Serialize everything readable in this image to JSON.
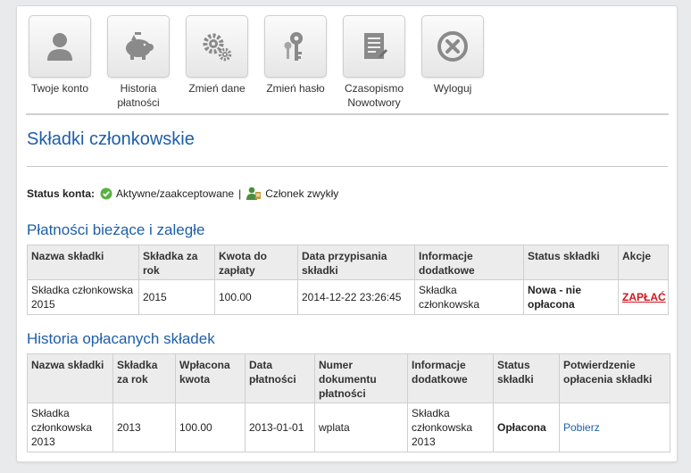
{
  "nav": [
    {
      "label": "Twoje konto",
      "icon": "user-icon"
    },
    {
      "label": "Historia płatności",
      "icon": "piggy-bank-icon"
    },
    {
      "label": "Zmień dane",
      "icon": "gears-icon"
    },
    {
      "label": "Zmień hasło",
      "icon": "keys-icon"
    },
    {
      "label": "Czasopismo Nowotwory",
      "icon": "document-icon"
    },
    {
      "label": "Wyloguj",
      "icon": "close-circle-icon"
    }
  ],
  "page_title": "Składki członkowskie",
  "status": {
    "label": "Status konta:",
    "account_status": "Aktywne/zaakceptowane",
    "separator": "|",
    "member_type": "Członek zwykły"
  },
  "current": {
    "heading": "Płatności bieżące i zaległe",
    "headers": [
      "Nazwa składki",
      "Składka za rok",
      "Kwota do zapłaty",
      "Data przypisania składki",
      "Informacje dodatkowe",
      "Status składki",
      "Akcje"
    ],
    "rows": [
      {
        "name": "Składka członkowska 2015",
        "year": "2015",
        "amount": "100.00",
        "date": "2014-12-22 23:26:45",
        "info": "Składka członkowska",
        "status": "Nowa - nie opłacona",
        "action": "ZAPŁAĆ"
      }
    ]
  },
  "history": {
    "heading": "Historia opłacanych składek",
    "headers": [
      "Nazwa składki",
      "Składka za rok",
      "Wpłacona kwota",
      "Data płatności",
      "Numer dokumentu płatności",
      "Informacje dodatkowe",
      "Status składki",
      "Potwierdzenie opłacenia składki"
    ],
    "rows": [
      {
        "name": "Składka członkowska 2013",
        "year": "2013",
        "amount": "100.00",
        "date": "2013-01-01",
        "doc": "wplata",
        "info": "Składka członkowska 2013",
        "status": "Opłacona",
        "confirm": "Pobierz"
      }
    ]
  },
  "colors": {
    "accent": "#1e5ea8",
    "pay": "#d0141e",
    "header_bg": "#ececec"
  }
}
